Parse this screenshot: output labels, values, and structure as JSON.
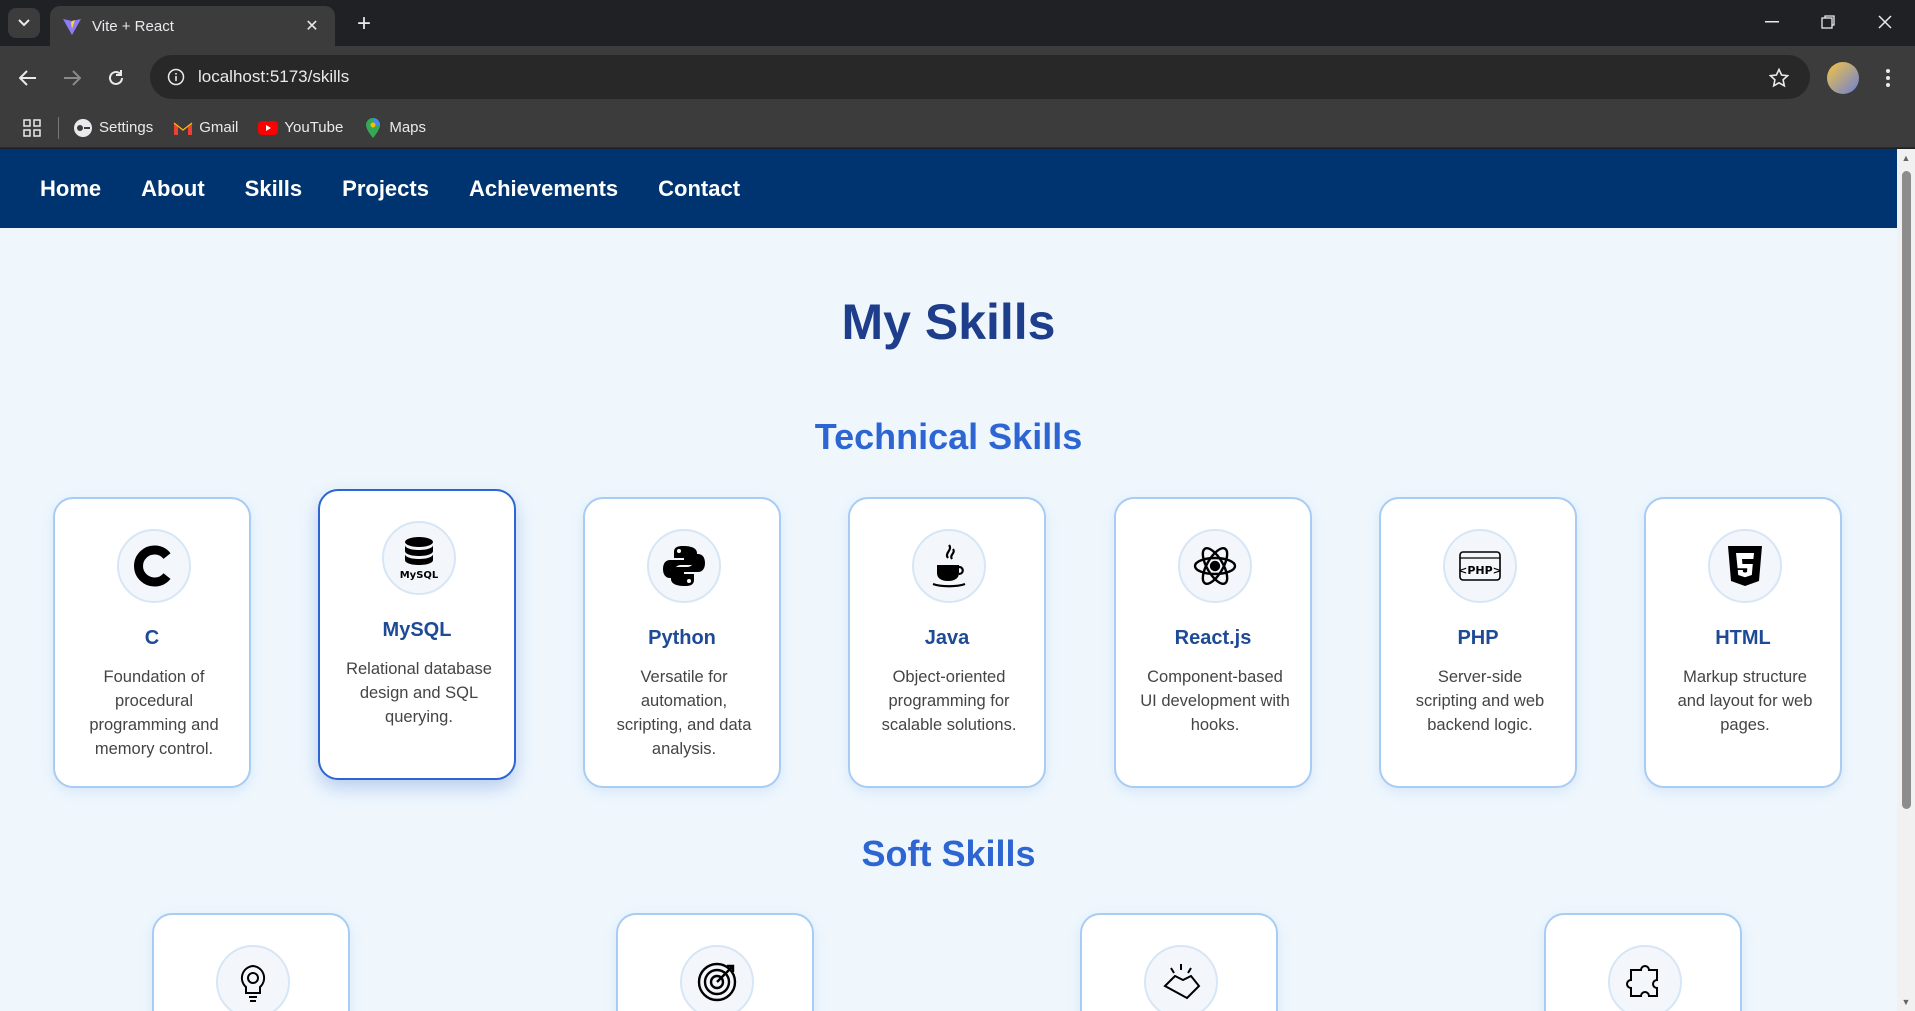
{
  "browser": {
    "tab_title": "Vite + React",
    "url": "localhost:5173/skills",
    "bookmarks": [
      {
        "label": "Settings",
        "icon": "settings-icon"
      },
      {
        "label": "Gmail",
        "icon": "gmail-icon"
      },
      {
        "label": "YouTube",
        "icon": "youtube-icon"
      },
      {
        "label": "Maps",
        "icon": "maps-icon"
      }
    ]
  },
  "nav": {
    "items": [
      "Home",
      "About",
      "Skills",
      "Projects",
      "Achievements",
      "Contact"
    ]
  },
  "page": {
    "title": "My Skills",
    "technical_title": "Technical Skills",
    "soft_title": "Soft Skills"
  },
  "technical_skills": [
    {
      "name": "C",
      "desc": "Foundation of procedural programming and memory control.",
      "icon": "c-letter-icon"
    },
    {
      "name": "MySQL",
      "desc": "Relational database design and SQL querying.",
      "icon": "mysql-database-icon"
    },
    {
      "name": "Python",
      "desc": "Versatile for automation, scripting, and data analysis.",
      "icon": "python-icon"
    },
    {
      "name": "Java",
      "desc": "Object-oriented programming for scalable solutions.",
      "icon": "java-cup-icon"
    },
    {
      "name": "React.js",
      "desc": "Component-based UI development with hooks.",
      "icon": "react-atom-icon"
    },
    {
      "name": "PHP",
      "desc": "Server-side scripting and web backend logic.",
      "icon": "php-icon"
    },
    {
      "name": "HTML",
      "desc": "Markup structure and layout for web pages.",
      "icon": "html5-icon"
    }
  ],
  "soft_skills": [
    {
      "icon": "lightbulb-gear-icon"
    },
    {
      "icon": "target-icon"
    },
    {
      "icon": "handshake-icon"
    },
    {
      "icon": "puzzle-icon"
    }
  ],
  "colors": {
    "nav_bg": "#003470",
    "page_bg": "#eff7fd",
    "title": "#1e3d8a",
    "section_title": "#2d66d2",
    "card_border": "#a8ccf3"
  }
}
